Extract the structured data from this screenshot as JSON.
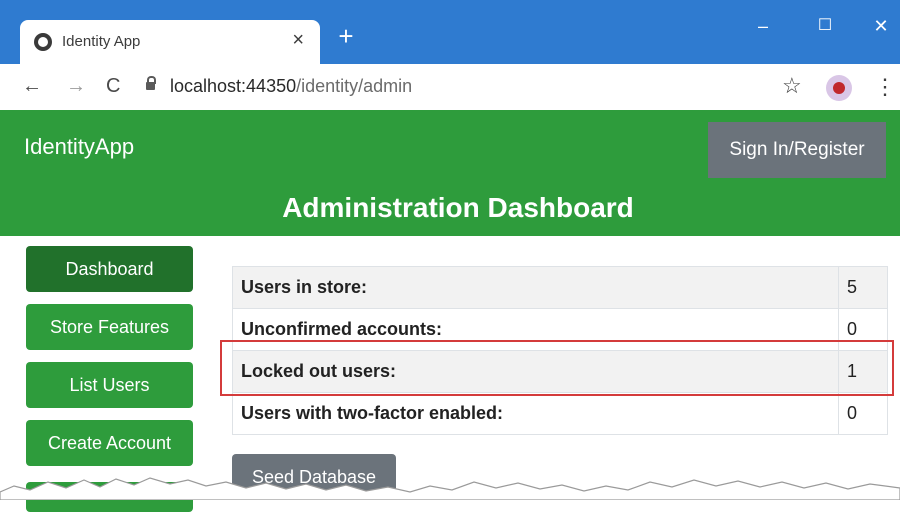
{
  "browser": {
    "tab": {
      "title": "Identity App",
      "close": "×"
    },
    "new_tab": "+",
    "window": {
      "minimize": "–",
      "maximize": "☐",
      "close": "✕"
    },
    "nav": {
      "back": "←",
      "forward": "→",
      "reload": "C"
    },
    "url": {
      "host": "localhost:44350",
      "path": "/identity/admin"
    },
    "star": "☆",
    "menu": "⋮"
  },
  "header": {
    "brand": "IdentityApp",
    "signin_label": "Sign In/Register",
    "title": "Administration Dashboard"
  },
  "sidebar": {
    "items": [
      {
        "label": "Dashboard"
      },
      {
        "label": "Store Features"
      },
      {
        "label": "List Users"
      },
      {
        "label": "Create Account"
      }
    ]
  },
  "stats": {
    "rows": [
      {
        "label": "Users in store:",
        "value": "5"
      },
      {
        "label": "Unconfirmed accounts:",
        "value": "0"
      },
      {
        "label": "Locked out users:",
        "value": "1"
      },
      {
        "label": "Users with two-factor enabled:",
        "value": "0"
      }
    ]
  },
  "actions": {
    "seed_label": "Seed Database"
  },
  "colors": {
    "chrome": "#2f7bd0",
    "brand_green": "#2e9c3c",
    "active_green": "#21712b",
    "secondary_gray": "#6b737b",
    "highlight_red": "#d43b3b"
  }
}
